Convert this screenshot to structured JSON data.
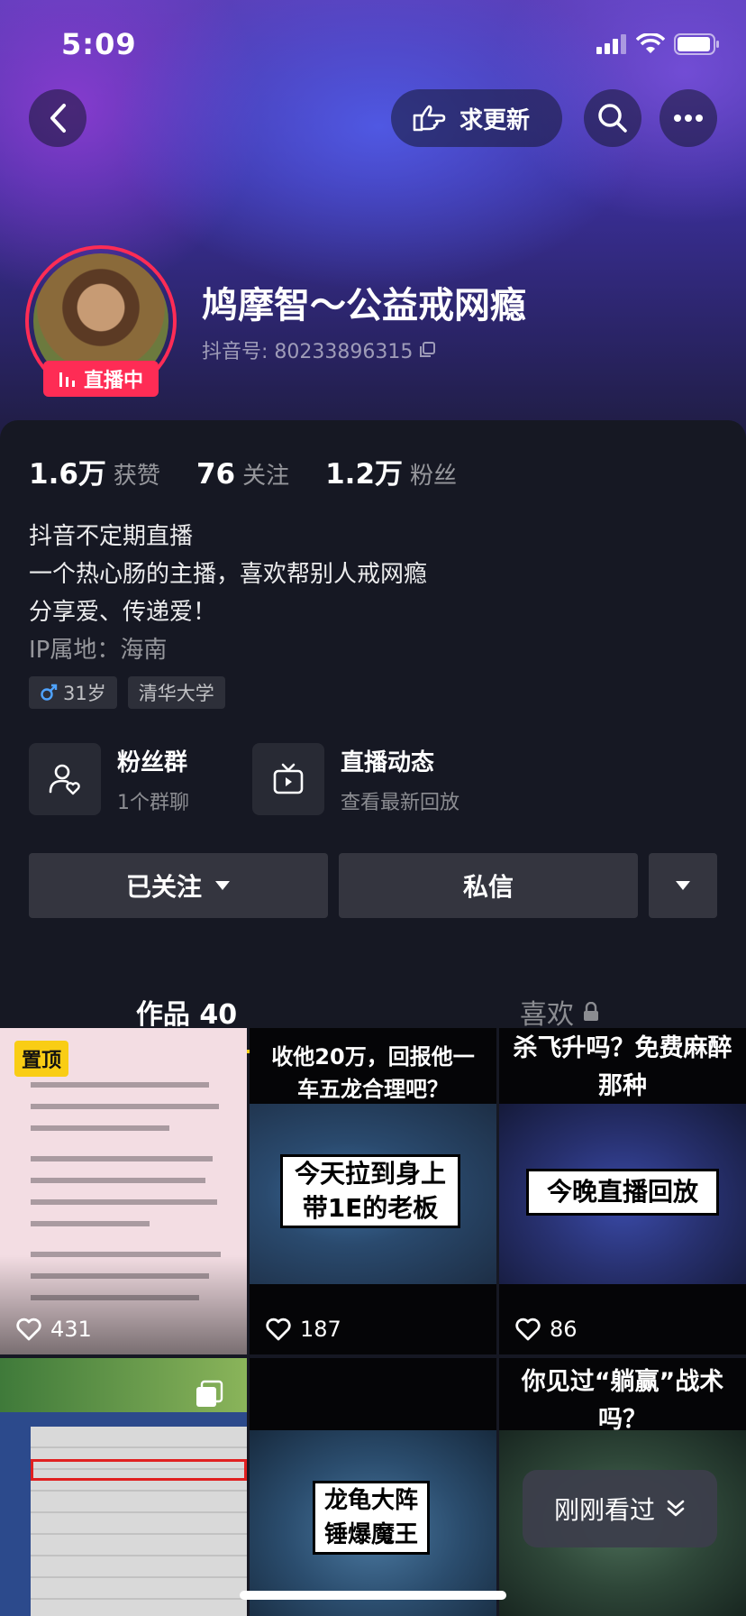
{
  "status_bar": {
    "time": "5:09"
  },
  "header": {
    "request_update_label": "求更新"
  },
  "profile": {
    "nickname": "鸠摩智～公益戒网瘾",
    "douyin_id": "抖音号: 80233896315",
    "live_badge": "直播中"
  },
  "stats": [
    {
      "value": "1.6万",
      "label": "获赞"
    },
    {
      "value": "76",
      "label": "关注"
    },
    {
      "value": "1.2万",
      "label": "粉丝"
    }
  ],
  "bio": {
    "lines": [
      "抖音不定期直播",
      "一个热心肠的主播，喜欢帮别人戒网瘾",
      "分享爱、传递爱！"
    ],
    "ip_location": "IP属地：海南"
  },
  "tags": {
    "age": "31岁",
    "school": "清华大学"
  },
  "features": {
    "fan_group": {
      "title": "粉丝群",
      "subtitle": "1个群聊"
    },
    "live_feed": {
      "title": "直播动态",
      "subtitle": "查看最新回放"
    }
  },
  "actions": {
    "followed_label": "已关注",
    "message_label": "私信"
  },
  "tabs": {
    "works": "作品 40",
    "likes": "喜欢"
  },
  "videos": [
    {
      "pinned_label": "置顶",
      "likes": "431",
      "caption": ""
    },
    {
      "likes": "187",
      "caption": "收他20万，回报他一车五龙合理吧？",
      "box_text": "今天拉到身上带1E的老板"
    },
    {
      "likes": "86",
      "caption": "杀飞升吗？免费麻醉那种",
      "box_text": "今晚直播回放"
    },
    {
      "likes": "",
      "caption": "",
      "box_text": ""
    },
    {
      "likes": "",
      "caption": "",
      "box_text": "龙龟大阵锤爆魔王"
    },
    {
      "likes": "",
      "caption": "你见过“躺赢”战术吗？",
      "box_text": ""
    }
  ],
  "recent_button": "刚刚看过",
  "colors": {
    "accent_red": "#fe2c55",
    "accent_yellow": "#f9cd15",
    "background": "#161823"
  }
}
